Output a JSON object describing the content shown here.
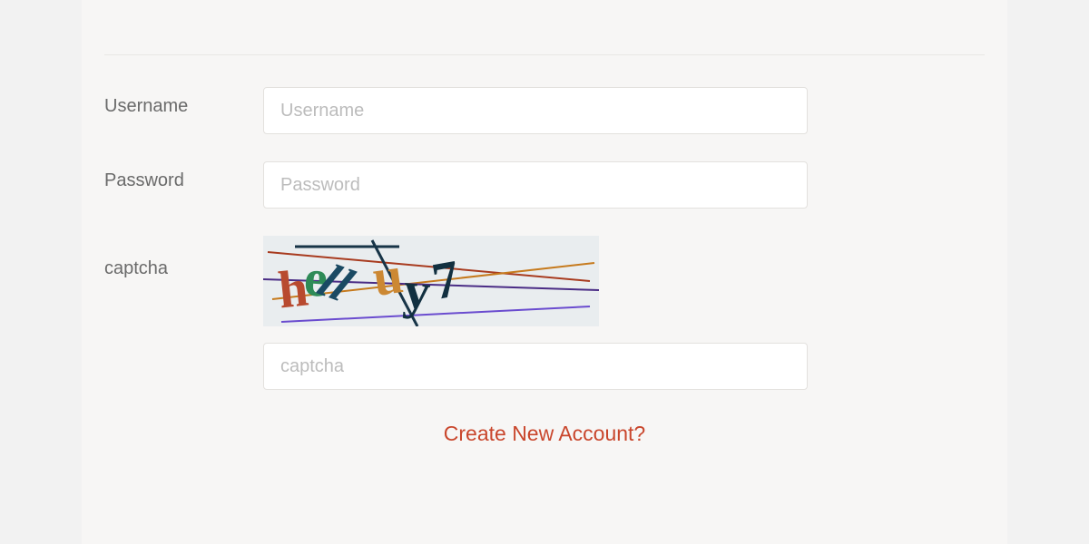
{
  "form": {
    "username": {
      "label": "Username",
      "placeholder": "Username",
      "value": ""
    },
    "password": {
      "label": "Password",
      "placeholder": "Password",
      "value": ""
    },
    "captcha": {
      "label": "captcha",
      "placeholder": "captcha",
      "value": "",
      "image_text": "hellu y7",
      "chars": [
        "h",
        "e",
        "ll",
        "u",
        "y",
        "7"
      ]
    }
  },
  "footer": {
    "create_account_link": "Create New Account?"
  },
  "colors": {
    "link": "#c9462c",
    "label": "#6a6a6a",
    "placeholder": "#bcbcbc",
    "captcha_bg": "#e9edef"
  }
}
